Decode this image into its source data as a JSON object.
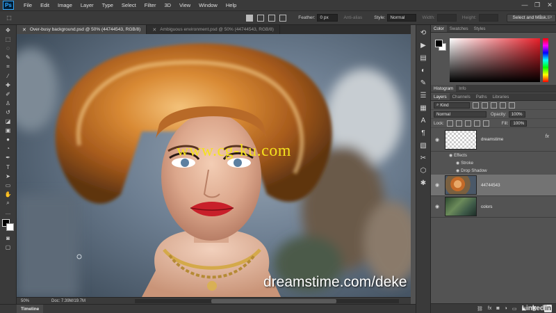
{
  "menubar": {
    "logo": "Ps",
    "items": [
      "File",
      "Edit",
      "Image",
      "Layer",
      "Type",
      "Select",
      "Filter",
      "3D",
      "View",
      "Window",
      "Help"
    ],
    "min": "—",
    "max": "❐",
    "close": "✕"
  },
  "options": {
    "feather_label": "Feather:",
    "feather_value": "0 px",
    "antialias_label": "Anti-alias",
    "style_label": "Style:",
    "style_value": "Normal",
    "width_label": "Width:",
    "height_label": "Height:",
    "select_mask_button": "Select and Mask..."
  },
  "tabs": [
    {
      "label": "Over-busy background.psd @ 50% (44744543, RGB/8)",
      "close": "✕"
    },
    {
      "label": "Ambiguous environment.psd @ 50% (44744543, RGB/8)",
      "close": "✕"
    }
  ],
  "canvas": {
    "watermark_top": "www.cg-ku.com",
    "watermark_bottom": "dreamstime.com/deke"
  },
  "status": {
    "zoom": "50%",
    "doc": "Doc: 7.39M/19.7M"
  },
  "timeline": {
    "label": "Timeline"
  },
  "panels": {
    "color_tabs": [
      "Color",
      "Swatches",
      "Styles"
    ],
    "histogram_tabs": [
      "Histogram",
      "Info"
    ],
    "layers_tabs": [
      "Layers",
      "Channels",
      "Paths",
      "Libraries"
    ],
    "kind": "Kind",
    "blend_mode": "Normal",
    "opacity_label": "Opacity:",
    "opacity_value": "100%",
    "lock_label": "Lock:",
    "fill_label": "Fill:",
    "fill_value": "100%"
  },
  "layers": [
    {
      "name": "dreamstime",
      "fx": "fx"
    },
    {
      "name": "44744543"
    },
    {
      "name": "colors"
    }
  ],
  "effects": {
    "title": "Effects",
    "items": [
      "Stroke",
      "Drop Shadow"
    ]
  },
  "brand": {
    "linked": "Linked",
    "in": "in"
  },
  "colors": {
    "accent": "#31a8ff",
    "watermark": "#f4e11e"
  }
}
